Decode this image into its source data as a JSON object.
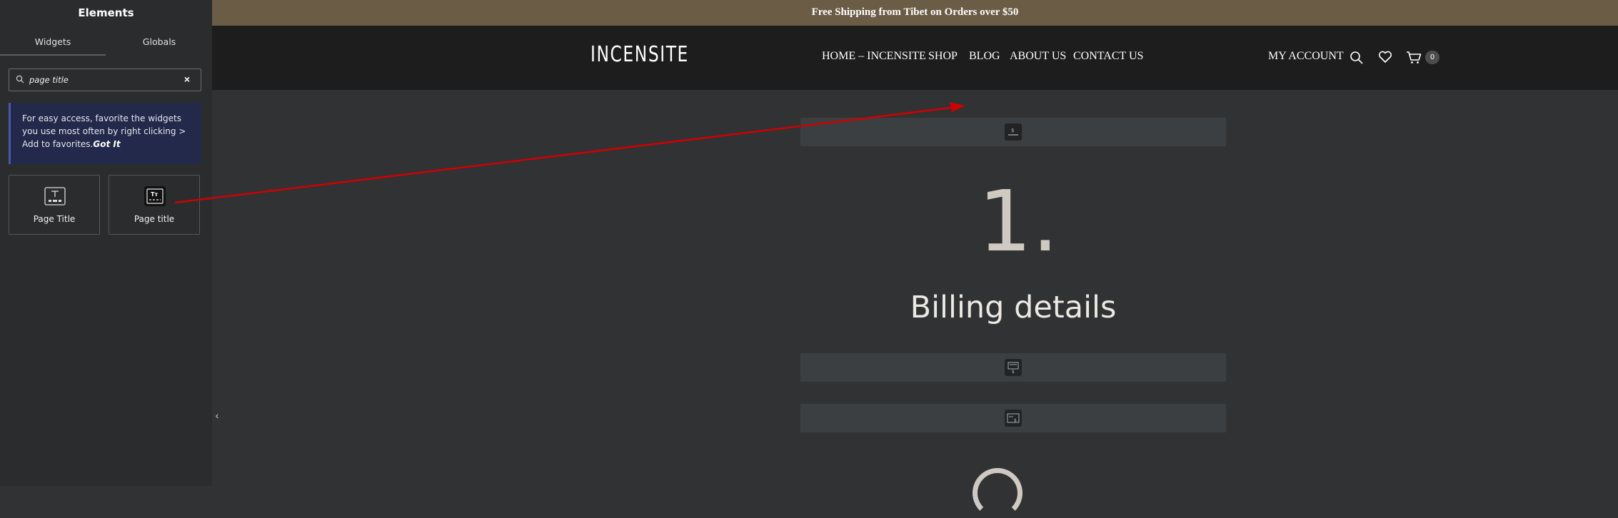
{
  "panel": {
    "title": "Elements",
    "tabs": [
      {
        "label": "Widgets"
      },
      {
        "label": "Globals"
      }
    ],
    "search": {
      "value": "page title",
      "clear_symbol": "×"
    },
    "notice": {
      "text": "For easy access, favorite the widgets you use most often by right clicking > Add to favorites.",
      "link": "Got It"
    },
    "widgets": [
      {
        "label": "Page Title"
      },
      {
        "label": "Page title"
      }
    ],
    "collapse_symbol": "‹"
  },
  "site": {
    "topbar": "Free Shipping from Tibet on Orders over $50",
    "logo": "INCENSITE",
    "nav": [
      "HOME – INCENSITE",
      "SHOP",
      "BLOG",
      "ABOUT US",
      "CONTACT US"
    ],
    "account": "MY ACCOUNT",
    "cart_count": "0"
  },
  "content": {
    "step_number": "1.",
    "heading": "Billing details"
  },
  "colors": {
    "topbar": "#6b5c46",
    "header": "#1d1d1d",
    "canvas": "#303234",
    "annotation_arrow": "#d00000"
  }
}
